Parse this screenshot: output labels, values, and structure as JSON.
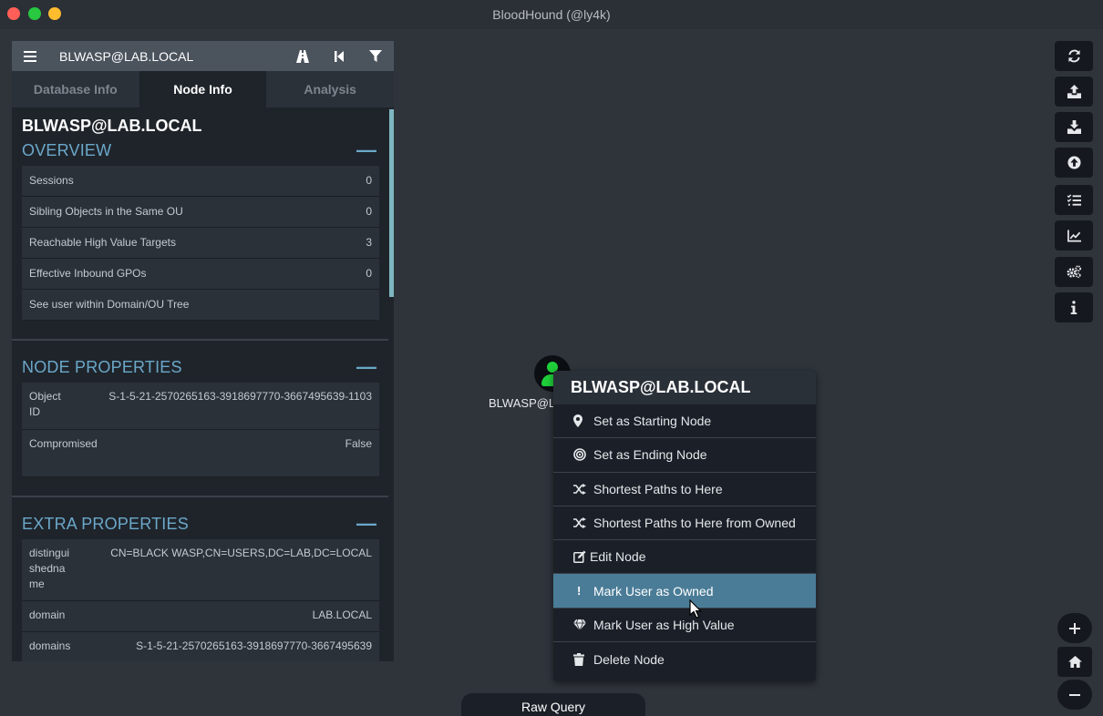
{
  "window": {
    "title": "BloodHound (@ly4k)"
  },
  "search": {
    "value": "BLWASP@LAB.LOCAL"
  },
  "tabs": [
    {
      "label": "Database Info"
    },
    {
      "label": "Node Info"
    },
    {
      "label": "Analysis"
    }
  ],
  "node_info": {
    "name": "BLWASP@LAB.LOCAL",
    "overview": {
      "title": "OVERVIEW",
      "rows": [
        {
          "label": "Sessions",
          "value": "0"
        },
        {
          "label": "Sibling Objects in the Same OU",
          "value": "0"
        },
        {
          "label": "Reachable High Value Targets",
          "value": "3"
        },
        {
          "label": "Effective Inbound GPOs",
          "value": "0"
        },
        {
          "label": "See user within Domain/OU Tree",
          "value": ""
        }
      ]
    },
    "node_properties": {
      "title": "NODE PROPERTIES",
      "rows": [
        {
          "label": "Object ID",
          "value": "S-1-5-21-2570265163-3918697770-3667495639-1103"
        },
        {
          "label": "Compromised",
          "value": "False"
        }
      ]
    },
    "extra_properties": {
      "title": "EXTRA PROPERTIES",
      "rows": [
        {
          "label": "distinguishedname",
          "value": "CN=BLACK WASP,CN=USERS,DC=LAB,DC=LOCAL"
        },
        {
          "label": "domain",
          "value": "LAB.LOCAL"
        },
        {
          "label": "domains",
          "value": "S-1-5-21-2570265163-3918697770-3667495639"
        }
      ]
    }
  },
  "graph": {
    "node_label": "BLWASP@L"
  },
  "context_menu": {
    "title": "BLWASP@LAB.LOCAL",
    "items": [
      {
        "label": "Set as Starting Node",
        "icon": "map-marker-icon"
      },
      {
        "label": "Set as Ending Node",
        "icon": "bullseye-icon"
      },
      {
        "label": "Shortest Paths to Here",
        "icon": "random-icon"
      },
      {
        "label": "Shortest Paths to Here from Owned",
        "icon": "random-icon"
      },
      {
        "label": "Edit Node",
        "icon": "edit-icon"
      },
      {
        "label": "Mark User as Owned",
        "icon": "exclamation-icon",
        "highlighted": true
      },
      {
        "label": "Mark User as High Value",
        "icon": "gem-icon"
      },
      {
        "label": "Delete Node",
        "icon": "trash-icon"
      }
    ]
  },
  "raw_query": {
    "label": "Raw Query"
  },
  "colors": {
    "accent": "#6ba8c9",
    "highlight": "#4a7c97",
    "node_user": "#1fcf3a"
  }
}
